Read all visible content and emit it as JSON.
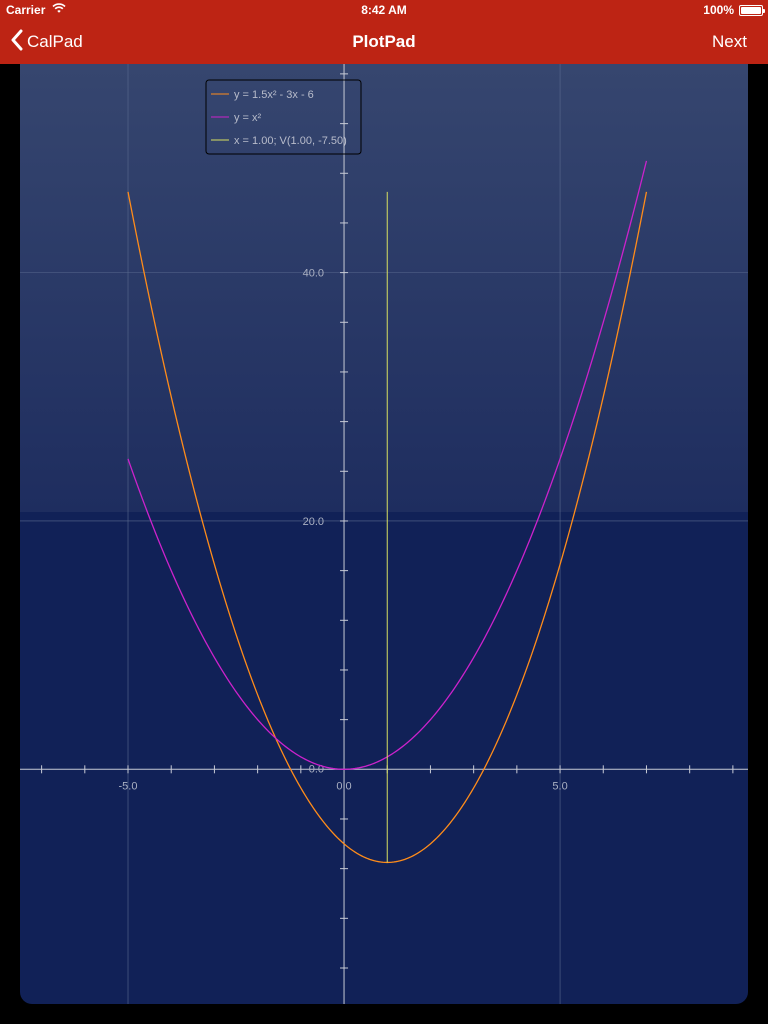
{
  "status": {
    "carrier": "Carrier",
    "time": "8:42 AM",
    "battery": "100%"
  },
  "nav": {
    "back_label": "CalPad",
    "title": "PlotPad",
    "next_label": "Next"
  },
  "colors": {
    "bar": "#bd2414",
    "plot_bg_top": "#36466f",
    "plot_bg_bottom": "#112157",
    "series1": "#ff8c1a",
    "series2": "#cc22cc",
    "vertex_line": "#d8e060",
    "axis": "#c8cbd6",
    "grid": "#5a6a8e"
  },
  "chart_data": {
    "type": "line",
    "xlim": [
      -7.5,
      9.35
    ],
    "ylim": [
      -18.9,
      56.8
    ],
    "x_ticks": [
      -5.0,
      0.0,
      5.0
    ],
    "x_tick_labels": [
      "-5.0",
      "0.0",
      "5.0"
    ],
    "y_ticks": [
      0.0,
      20.0,
      40.0
    ],
    "y_tick_labels": [
      "0.0",
      "20.0",
      "40.0"
    ],
    "minor_step_x": 1,
    "minor_step_y": 4,
    "grid": true,
    "legend_position": "top-left",
    "legend": [
      "y = 1.5x² - 3x - 6",
      "y = x²",
      "x = 1.00; V(1.00, -7.50)"
    ],
    "series": [
      {
        "name": "y = 1.5x² - 3x - 6",
        "a": 1.5,
        "b": -3,
        "c": -6,
        "x_range": [
          -5,
          7
        ]
      },
      {
        "name": "y = x²",
        "a": 1,
        "b": 0,
        "c": 0,
        "x_range": [
          -5,
          7
        ]
      }
    ],
    "vertex_line": {
      "x": 1.0,
      "y_range": [
        -7.5,
        46.5
      ],
      "label": "x = 1.00; V(1.00, -7.50)"
    }
  }
}
